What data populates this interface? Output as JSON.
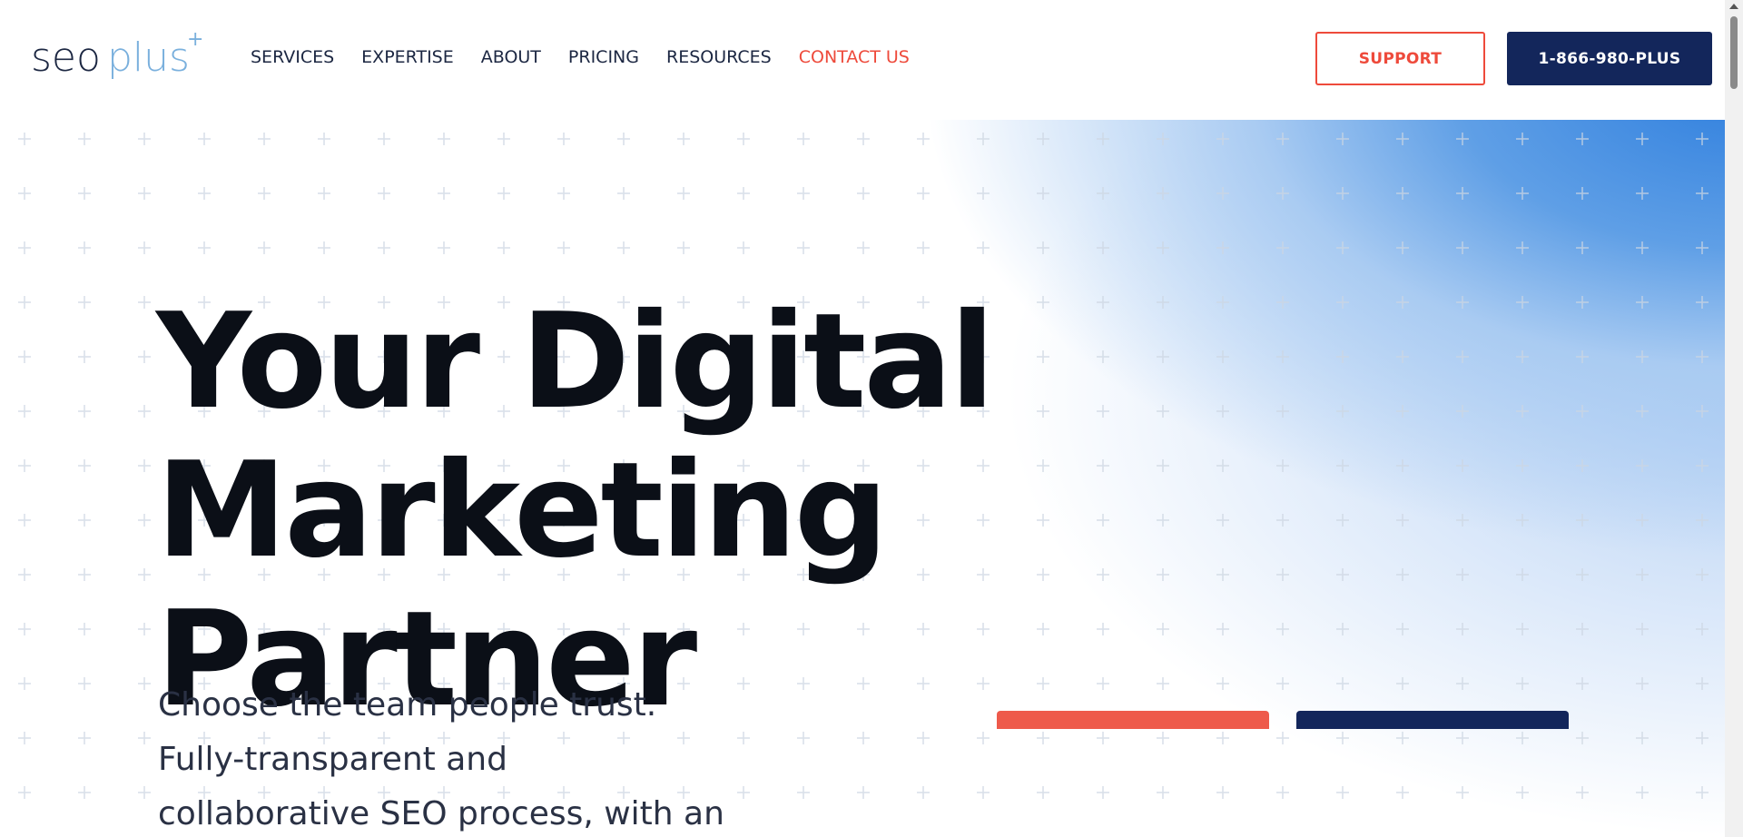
{
  "logo": {
    "text_main": "seo",
    "text_accent": "plus",
    "superscript": "+"
  },
  "nav": {
    "items": [
      {
        "label": "SERVICES"
      },
      {
        "label": "EXPERTISE"
      },
      {
        "label": "ABOUT"
      },
      {
        "label": "PRICING"
      },
      {
        "label": "RESOURCES"
      },
      {
        "label": "CONTACT US"
      }
    ]
  },
  "header_buttons": {
    "support": "SUPPORT",
    "phone": "1-866-980-PLUS"
  },
  "hero": {
    "headline_line1": "Your Digital",
    "headline_line2": "Marketing Partner",
    "subtext_line1": "Choose the team people trust.",
    "subtext_line2": "Fully-transparent and",
    "subtext_line3": "collaborative SEO process, with an"
  },
  "colors": {
    "accent_red": "#ee4a3b",
    "brand_navy": "#13265b",
    "hero_blue": "#2f7fde",
    "logo_blue": "#7ab0dd"
  }
}
